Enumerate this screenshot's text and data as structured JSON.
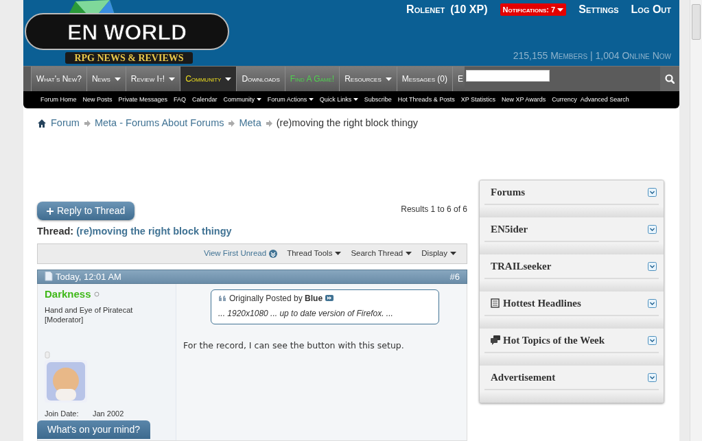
{
  "user_bar": {
    "username": "Rolenet",
    "xp": "(10 XP)",
    "notifications": "Notifications: 7",
    "links": [
      "Settings",
      "Log Out"
    ]
  },
  "logo": {
    "title": "EN WORLD",
    "tagline": "RPG NEWS & REVIEWS"
  },
  "stats": {
    "members": "215,155",
    "members_label": "Members",
    "separator": "|",
    "online": "1,004",
    "online_label": "Online Now"
  },
  "main_nav": [
    {
      "label": "What's New?",
      "dropdown": false,
      "selected": false,
      "kind": "plain"
    },
    {
      "label": "News",
      "dropdown": true,
      "selected": false,
      "kind": "plain"
    },
    {
      "label": "Review It!",
      "dropdown": true,
      "selected": false,
      "kind": "plain"
    },
    {
      "label": "Community",
      "dropdown": true,
      "selected": true,
      "kind": "plain"
    },
    {
      "label": "Downloads",
      "dropdown": false,
      "selected": false,
      "kind": "plain"
    },
    {
      "label": "Find A Game!",
      "dropdown": false,
      "selected": false,
      "kind": "featured"
    },
    {
      "label": "Resources",
      "dropdown": true,
      "selected": false,
      "kind": "plain"
    },
    {
      "label": "Messages (0)",
      "dropdown": false,
      "selected": false,
      "kind": "plain"
    },
    {
      "label": "E",
      "dropdown": false,
      "selected": false,
      "kind": "plain"
    }
  ],
  "sub_nav": [
    {
      "label": "Forum Home",
      "dropdown": false
    },
    {
      "label": "New Posts",
      "dropdown": false
    },
    {
      "label": "Private Messages",
      "dropdown": false
    },
    {
      "label": "FAQ",
      "dropdown": false
    },
    {
      "label": "Calendar",
      "dropdown": false
    },
    {
      "label": "Community",
      "dropdown": true
    },
    {
      "label": "Forum Actions",
      "dropdown": true
    },
    {
      "label": "Quick Links",
      "dropdown": true
    },
    {
      "label": "Subscribe",
      "dropdown": false
    },
    {
      "label": "Hot Threads & Posts",
      "dropdown": false
    },
    {
      "label": "XP Statistics",
      "dropdown": false
    },
    {
      "label": "New XP Awards",
      "dropdown": false
    },
    {
      "label": "Currency",
      "dropdown": false
    }
  ],
  "advanced_search": "Advanced Search",
  "breadcrumb": [
    {
      "label": "Forum",
      "current": false
    },
    {
      "label": "Meta - Forums About Forums",
      "current": false
    },
    {
      "label": "Meta",
      "current": false
    },
    {
      "label": "(re)moving the right block thingy",
      "current": true
    }
  ],
  "reply_button": "Reply to Thread",
  "results": "Results 1 to 6 of 6",
  "thread_title": {
    "prefix": "Thread:",
    "title": "(re)moving the right block thingy"
  },
  "thread_tools": [
    {
      "label": "View First Unread",
      "kind": "link"
    },
    {
      "label": "Thread Tools",
      "kind": "menu"
    },
    {
      "label": "Search Thread",
      "kind": "menu"
    },
    {
      "label": "Display",
      "kind": "menu"
    }
  ],
  "post": {
    "date": "Today, 12:01 AM",
    "number": "#6",
    "author": "Darkness",
    "online": false,
    "user_title": "Hand and Eye of Piratecat [Moderator]",
    "join_date_label": "Join Date:",
    "join_date": "Jan 2002",
    "quote": {
      "prefix": "Originally Posted by",
      "author": "Blue",
      "text": "... 1920x1080 ... up to date version of Firefox. ..."
    },
    "message": "For the record, I can see the button with this setup."
  },
  "sidebar_blocks": [
    {
      "title": "Forums",
      "kind": "plain"
    },
    {
      "title": "EN5ider",
      "kind": "plain"
    },
    {
      "title": "TRAILseeker",
      "kind": "plain"
    },
    {
      "title": "Hottest Headlines",
      "kind": "newspaper"
    },
    {
      "title": "Hot Topics of the Week",
      "kind": "chat"
    },
    {
      "title": "Advertisement",
      "kind": "plain"
    }
  ],
  "floating_button": "What's on your mind?"
}
